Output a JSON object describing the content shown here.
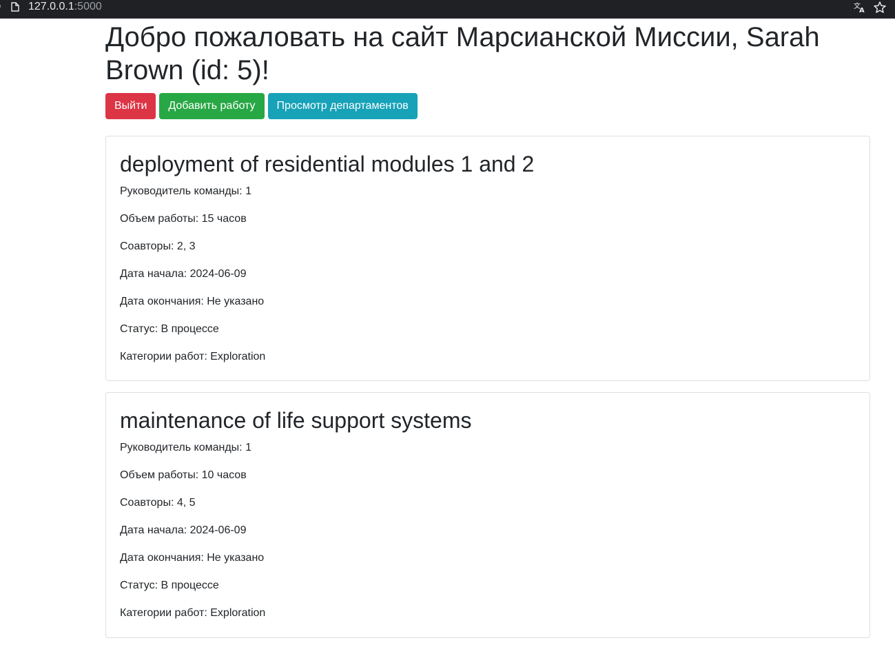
{
  "browser": {
    "url_host": "127.0.0.1",
    "url_port": ":5000"
  },
  "page": {
    "title": "Добро пожаловать на сайт Марсианской Миссии, Sarah Brown (id: 5)!",
    "buttons": {
      "logout": "Выйти",
      "add_job": "Добавить работу",
      "departments": "Просмотр департаментов"
    },
    "colors": {
      "danger": "#dc3545",
      "success": "#28a745",
      "info": "#17a2b8"
    }
  },
  "jobs": [
    {
      "title": "deployment of residential modules 1 and 2",
      "team_leader": "Руководитель команды: 1",
      "work_size": "Объем работы: 15 часов",
      "collaborators": "Соавторы: 2, 3",
      "start_date": "Дата начала: 2024-06-09",
      "end_date": "Дата окончания: Не указано",
      "status": "Статус: В процессе",
      "categories": "Категории работ: Exploration"
    },
    {
      "title": "maintenance of life support systems",
      "team_leader": "Руководитель команды: 1",
      "work_size": "Объем работы: 10 часов",
      "collaborators": "Соавторы: 4, 5",
      "start_date": "Дата начала: 2024-06-09",
      "end_date": "Дата окончания: Не указано",
      "status": "Статус: В процессе",
      "categories": "Категории работ: Exploration"
    }
  ]
}
